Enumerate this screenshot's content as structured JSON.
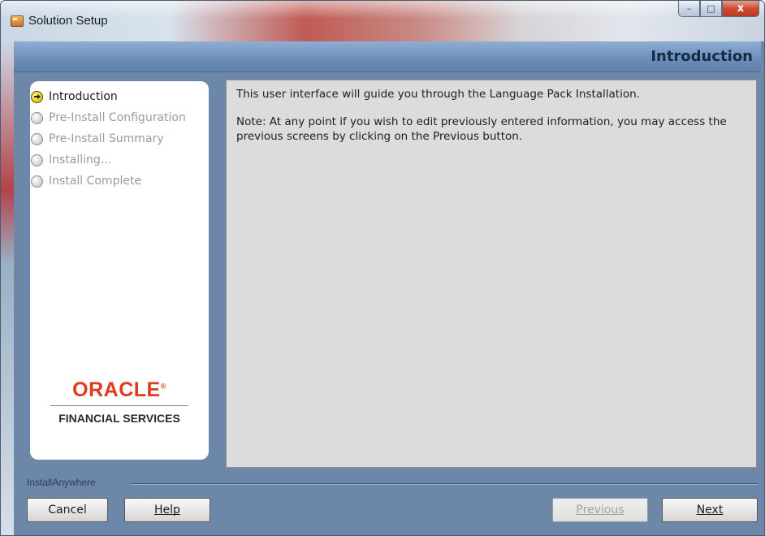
{
  "window": {
    "title": "Solution Setup",
    "controls": {
      "minimize": "–",
      "maximize": "□",
      "close": "x"
    }
  },
  "header": {
    "title": "Introduction"
  },
  "steps": [
    {
      "label": "Introduction",
      "state": "current"
    },
    {
      "label": "Pre-Install Configuration",
      "state": "pending"
    },
    {
      "label": "Pre-Install Summary",
      "state": "pending"
    },
    {
      "label": "Installing...",
      "state": "pending"
    },
    {
      "label": "Install Complete",
      "state": "pending"
    }
  ],
  "logo": {
    "brand": "ORACLE",
    "trademark": "®",
    "subtitle": "FINANCIAL SERVICES"
  },
  "content": {
    "intro": "This user interface will guide you through the Language Pack Installation.",
    "note": "Note: At any point if you wish to edit previously entered information, you may access the previous screens by clicking on the Previous button."
  },
  "footer": {
    "installer_label": "InstallAnywhere",
    "cancel_label": "Cancel",
    "help_label": "Help",
    "previous_label": "Previous",
    "next_label": "Next"
  },
  "colors": {
    "window_bg": "#6d87a8",
    "header_band": "#6b8db8",
    "content_bg": "#dcdcdc",
    "oracle_red": "#e03a1e",
    "current_step": "#f0d21a"
  }
}
